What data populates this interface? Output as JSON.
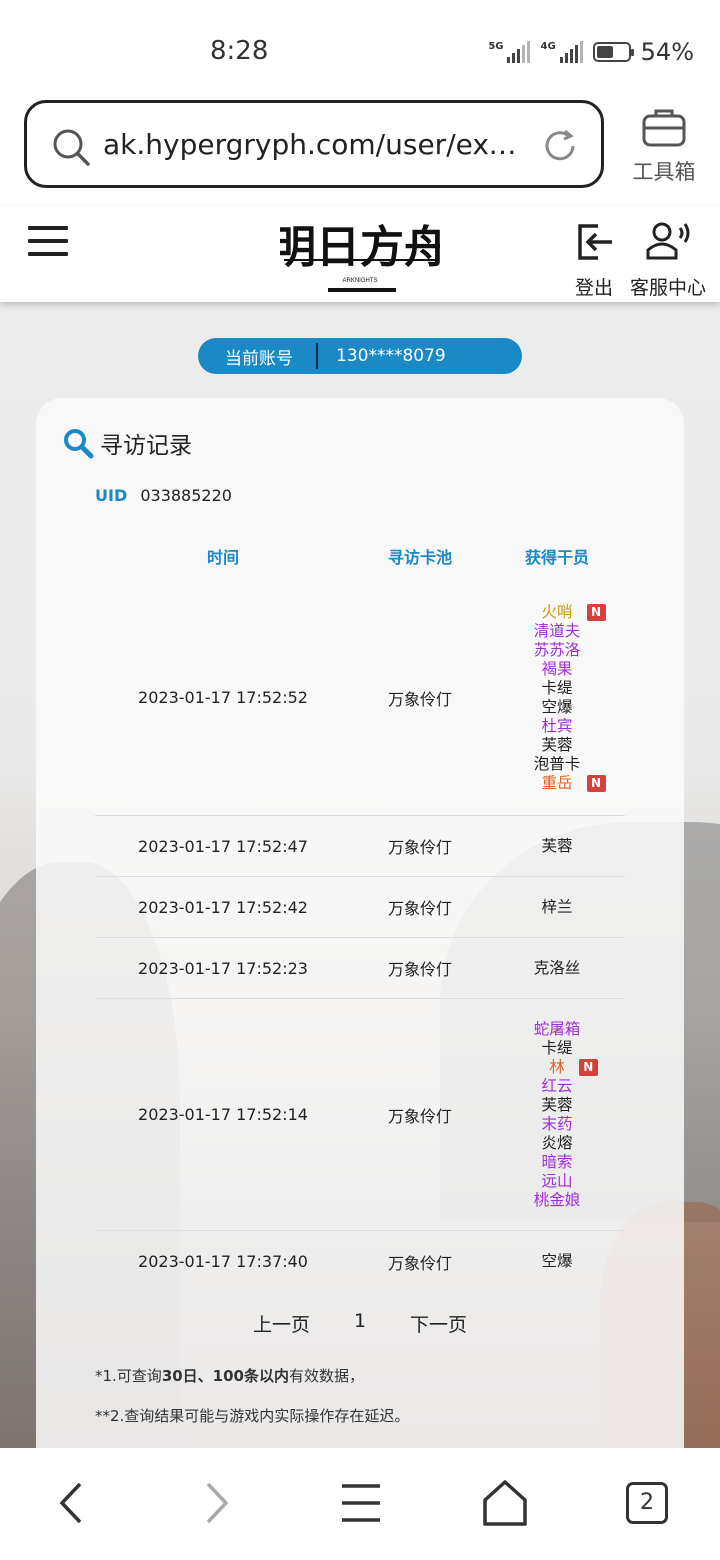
{
  "status_bar": {
    "time": "8:28",
    "net1": "5G",
    "net2": "4G",
    "battery_level": 0.54,
    "battery_text": "54%"
  },
  "browser": {
    "url": "ak.hypergryph.com/user/exch...",
    "toolbox_label": "工具箱",
    "icons": [
      "search-icon",
      "reload-icon",
      "toolbox-icon"
    ]
  },
  "header": {
    "logo_sub": "ARKNIGHTS",
    "logout_label": "登出",
    "service_label": "客服中心"
  },
  "account": {
    "label": "当前账号",
    "value": "130****8079"
  },
  "record": {
    "title": "寻访记录",
    "uid_label": "UID",
    "uid_value": "033885220",
    "columns": [
      "时间",
      "寻访卡池",
      "获得干员"
    ],
    "rows": [
      {
        "time": "2023-01-17 17:52:52",
        "pool": "万象伶仃",
        "ops": [
          {
            "name": "火哨",
            "rarity": 5,
            "new": true
          },
          {
            "name": "清道夫",
            "rarity": 4,
            "new": false
          },
          {
            "name": "苏苏洛",
            "rarity": 4,
            "new": false
          },
          {
            "name": "褐果",
            "rarity": 4,
            "new": false
          },
          {
            "name": "卡缇",
            "rarity": 3,
            "new": false
          },
          {
            "name": "空爆",
            "rarity": 3,
            "new": false
          },
          {
            "name": "杜宾",
            "rarity": 4,
            "new": false
          },
          {
            "name": "芙蓉",
            "rarity": 3,
            "new": false
          },
          {
            "name": "泡普卡",
            "rarity": 3,
            "new": false
          },
          {
            "name": "重岳",
            "rarity": 6,
            "new": true
          }
        ]
      },
      {
        "time": "2023-01-17 17:52:47",
        "pool": "万象伶仃",
        "ops": [
          {
            "name": "芙蓉",
            "rarity": 3,
            "new": false
          }
        ]
      },
      {
        "time": "2023-01-17 17:52:42",
        "pool": "万象伶仃",
        "ops": [
          {
            "name": "梓兰",
            "rarity": 3,
            "new": false
          }
        ]
      },
      {
        "time": "2023-01-17 17:52:23",
        "pool": "万象伶仃",
        "ops": [
          {
            "name": "克洛丝",
            "rarity": 3,
            "new": false
          }
        ]
      },
      {
        "time": "2023-01-17 17:52:14",
        "pool": "万象伶仃",
        "ops": [
          {
            "name": "蛇屠箱",
            "rarity": 4,
            "new": false
          },
          {
            "name": "卡缇",
            "rarity": 3,
            "new": false
          },
          {
            "name": "林",
            "rarity": 6,
            "new": true
          },
          {
            "name": "红云",
            "rarity": 4,
            "new": false
          },
          {
            "name": "芙蓉",
            "rarity": 3,
            "new": false
          },
          {
            "name": "末药",
            "rarity": 4,
            "new": false
          },
          {
            "name": "炎熔",
            "rarity": 3,
            "new": false
          },
          {
            "name": "暗索",
            "rarity": 4,
            "new": false
          },
          {
            "name": "远山",
            "rarity": 4,
            "new": false
          },
          {
            "name": "桃金娘",
            "rarity": 4,
            "new": false
          }
        ]
      },
      {
        "time": "2023-01-17 17:37:40",
        "pool": "万象伶仃",
        "ops": [
          {
            "name": "空爆",
            "rarity": 3,
            "new": false
          }
        ]
      }
    ],
    "new_badge": "N",
    "rarity_colors": {
      "3": "#222222",
      "4": "#a12fd9",
      "5": "#c79a0a",
      "6": "#e0601e"
    },
    "pager": {
      "prev": "上一页",
      "page": "1",
      "next": "下一页"
    },
    "notes": [
      {
        "pre": "*1.可查询",
        "bold": "30日、100条以内",
        "post": "有效数据，"
      },
      {
        "pre": "**2.查询结果可能与游戏内实际操作存在延迟。",
        "bold": "",
        "post": ""
      }
    ]
  },
  "bottom_nav": {
    "icons": [
      "back-icon",
      "forward-icon",
      "menu-icon",
      "home-icon",
      "tabs-icon"
    ],
    "tab_count": "2"
  }
}
